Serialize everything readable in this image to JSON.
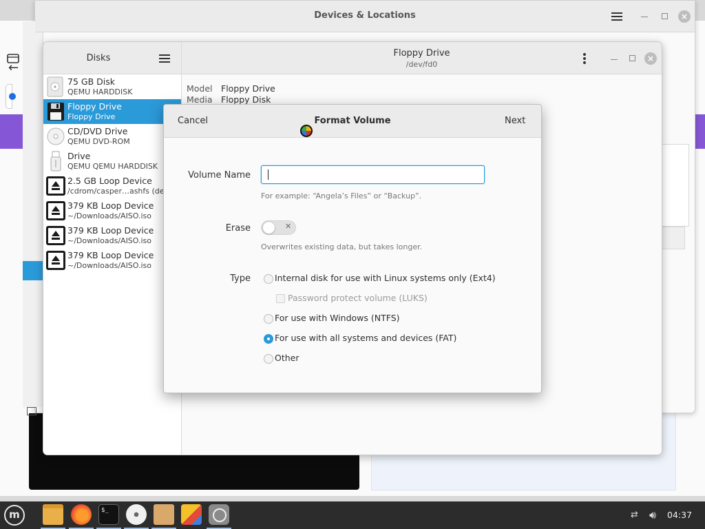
{
  "devices_window": {
    "title": "Devices & Locations"
  },
  "disks_window": {
    "sidebar_title": "Disks",
    "drives": [
      {
        "name": "75 GB Disk",
        "sub": "QEMU HARDDISK",
        "icon": "hard-disk-icon"
      },
      {
        "name": "Floppy Drive",
        "sub": "Floppy Drive",
        "icon": "floppy-icon",
        "selected": true
      },
      {
        "name": "CD/DVD Drive",
        "sub": "QEMU DVD-ROM",
        "icon": "optical-disc-icon"
      },
      {
        "name": "Drive",
        "sub": "QEMU QEMU HARDDISK",
        "icon": "usb-drive-icon"
      },
      {
        "name": "2.5 GB Loop Device",
        "sub": "/cdrom/casper…ashfs (dele",
        "icon": "eject-icon"
      },
      {
        "name": "379 KB Loop Device",
        "sub": "~/Downloads/AISO.iso",
        "icon": "eject-icon"
      },
      {
        "name": "379 KB Loop Device",
        "sub": "~/Downloads/AISO.iso",
        "icon": "eject-icon"
      },
      {
        "name": "379 KB Loop Device",
        "sub": "~/Downloads/AISO.iso",
        "icon": "eject-icon"
      }
    ],
    "header": {
      "title": "Floppy Drive",
      "subtitle": "/dev/fd0"
    },
    "properties": {
      "model_label": "Model",
      "model_value": "Floppy Drive",
      "media_label": "Media",
      "media_value": "Floppy Disk"
    }
  },
  "format_dialog": {
    "cancel_label": "Cancel",
    "title": "Format Volume",
    "next_label": "Next",
    "volume_name_label": "Volume Name",
    "volume_name_value": "",
    "volume_name_hint": "For example: “Angela’s Files” or “Backup”.",
    "erase_label": "Erase",
    "erase_on": false,
    "erase_hint": "Overwrites existing data, but takes longer.",
    "type_label": "Type",
    "types": [
      {
        "label": "Internal disk for use with Linux systems only (Ext4)",
        "checked": false
      },
      {
        "label": "For use with Windows (NTFS)",
        "checked": false
      },
      {
        "label": "For use with all systems and devices (FAT)",
        "checked": true
      },
      {
        "label": "Other",
        "checked": false
      }
    ],
    "luks_label": "Password protect volume (LUKS)",
    "luks_checked": false,
    "luks_enabled": false
  },
  "taskbar": {
    "apps": [
      "file-manager-icon",
      "firefox-icon",
      "terminal-icon",
      "disc-icon",
      "archive-icon",
      "office-icon",
      "disks-icon"
    ],
    "terminal_glyph": "$_",
    "clock": "04:37"
  },
  "colors": {
    "accent": "#2b9ad8",
    "purple_band": "#8556d6",
    "taskbar": "#2c2c2c"
  }
}
